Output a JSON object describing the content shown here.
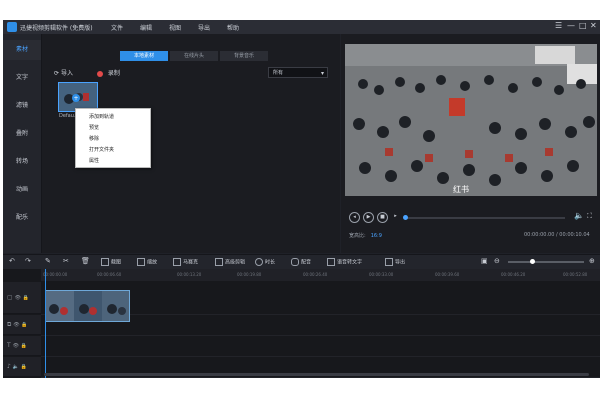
{
  "app": {
    "title": "迅捷视频剪辑软件 (免费版)",
    "menus": [
      "文件",
      "编辑",
      "视图",
      "导出",
      "帮助"
    ],
    "account": "请问您好 16:32"
  },
  "sidebar": {
    "items": [
      {
        "label": "素材",
        "active": true
      },
      {
        "label": "文字",
        "active": false
      },
      {
        "label": "滤镜",
        "active": false
      },
      {
        "label": "叠附",
        "active": false
      },
      {
        "label": "转场",
        "active": false
      },
      {
        "label": "动画",
        "active": false
      },
      {
        "label": "配乐",
        "active": false
      }
    ]
  },
  "library": {
    "tabs": [
      {
        "label": "本地素材",
        "active": true
      },
      {
        "label": "在线片头",
        "active": false
      },
      {
        "label": "背景音乐",
        "active": false
      }
    ],
    "import_label": "导入",
    "record_label": "录制",
    "sort_value": "所有",
    "thumb_label": "Defau..."
  },
  "context_menu": {
    "items": [
      "添加到轨道",
      "预览",
      "移除",
      "打开文件夹",
      "属性"
    ]
  },
  "preview": {
    "watermark": "红书",
    "ratio_label": "宽高比:",
    "ratio_value": "16:9",
    "timecode": "00:00:00.00 / 00:00:10.04",
    "progress": 0.0
  },
  "toolbar": {
    "tools": [
      "截图",
      "缩放",
      "马赛克",
      "高级剪辑",
      "时长",
      "配音",
      "语音转文字",
      "导出"
    ]
  },
  "timeline": {
    "ticks": [
      "00:00:00.00",
      "00:00:06.60",
      "00:00:13.20",
      "00:00:19.80",
      "00:00:26.40",
      "00:00:33.00",
      "00:00:39.60",
      "00:00:46.20",
      "00:00:52.80"
    ]
  },
  "colors": {
    "accent": "#2f8fe8",
    "background": "#1f2128",
    "panel": "#1b1c21"
  }
}
